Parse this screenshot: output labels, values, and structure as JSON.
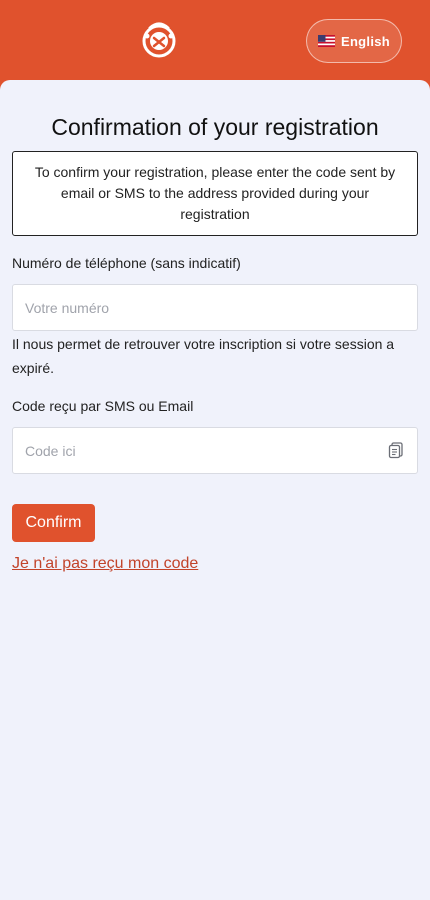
{
  "header": {
    "language_label": "English",
    "language_flag": "us-flag-icon",
    "logo": "mascot-logo"
  },
  "page": {
    "title": "Confirmation of your registration",
    "info": "To confirm your registration, please enter the code sent by email or SMS to the address provided during your registration"
  },
  "form": {
    "phone_label": "Numéro de téléphone (sans indicatif)",
    "phone_placeholder": "Votre numéro",
    "phone_value": "",
    "phone_help": "Il nous permet de retrouver votre inscription si votre session a expiré.",
    "code_label": "Code reçu par SMS ou Email",
    "code_placeholder": "Code ici",
    "code_value": "",
    "code_icon": "paste-icon",
    "confirm_label": "Confirm",
    "resend_link": "Je n'ai pas reçu mon code"
  },
  "colors": {
    "brand": "#e0522d",
    "background": "#f0f2fb",
    "link": "#c2432a"
  }
}
